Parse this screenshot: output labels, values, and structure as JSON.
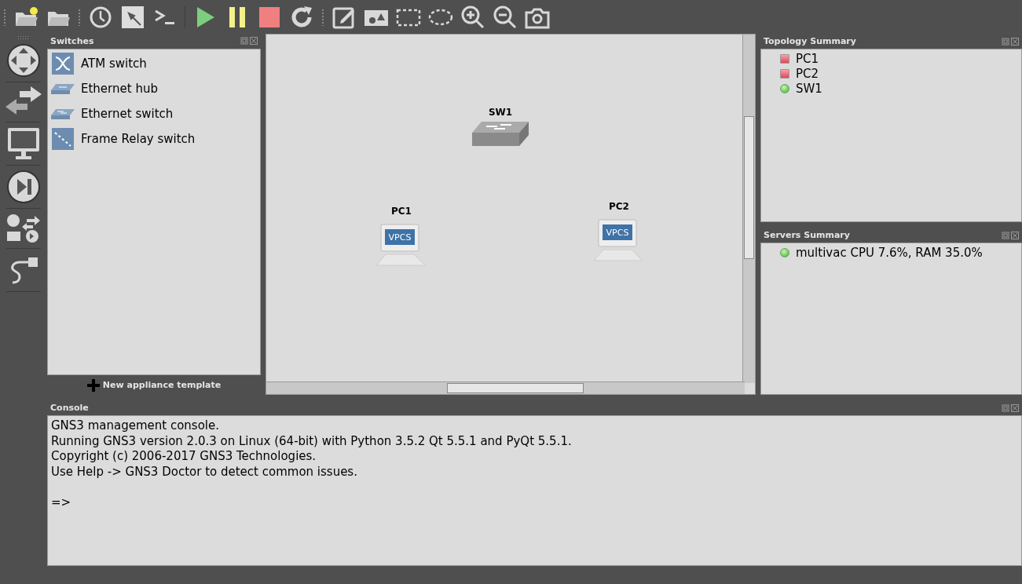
{
  "switches_panel": {
    "title": "Switches",
    "items": [
      {
        "label": "ATM switch",
        "kind": "atm"
      },
      {
        "label": "Ethernet hub",
        "kind": "hub"
      },
      {
        "label": "Ethernet switch",
        "kind": "switch"
      },
      {
        "label": "Frame Relay switch",
        "kind": "frame_relay"
      }
    ],
    "new_template_button": "New appliance template"
  },
  "canvas": {
    "nodes": [
      {
        "label": "SW1",
        "kind": "switch"
      },
      {
        "label": "PC1",
        "kind": "vpcs",
        "screen_text": "VPCS"
      },
      {
        "label": "PC2",
        "kind": "vpcs",
        "screen_text": "VPCS"
      }
    ]
  },
  "topology_summary": {
    "title": "Topology Summary",
    "items": [
      {
        "label": "PC1",
        "running": false
      },
      {
        "label": "PC2",
        "running": false
      },
      {
        "label": "SW1",
        "running": true
      }
    ]
  },
  "servers_summary": {
    "title": "Servers Summary",
    "items": [
      {
        "label": "multivac CPU 7.6%, RAM 35.0%",
        "running": true
      }
    ]
  },
  "console": {
    "title": "Console",
    "lines": [
      "GNS3 management console.",
      "Running GNS3 version 2.0.3 on Linux (64-bit) with Python 3.5.2 Qt 5.5.1 and PyQt 5.5.1.",
      "Copyright (c) 2006-2017 GNS3 Technologies.",
      "Use Help -> GNS3 Doctor to detect common issues."
    ],
    "prompt": "=>"
  }
}
